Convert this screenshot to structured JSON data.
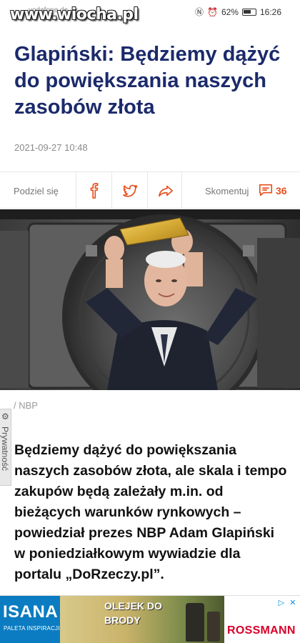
{
  "status_bar": {
    "watermark": "www.wiocha.pl",
    "carrier": "vodafone.de",
    "battery": "62%",
    "time": "16:26"
  },
  "article": {
    "headline": "Glapiński: Będziemy dążyć do powiększania naszych zasobów złota",
    "date": "2021-09-27 10:48",
    "photo_caption": "/ NBP",
    "lead": "Będziemy dążyć do powiększania naszych zasobów złota, ale skala i tempo zakupów będą zależały m.in. od bieżących warunków rynkowych – powiedział prezes NBP Adam Glapiński w poniedziałkowym wywiadzie dla portalu „DoRzeczy.pl”."
  },
  "share_bar": {
    "share_label": "Podziel się",
    "comment_label": "Skomentuj",
    "comment_count": "36",
    "accent": "#e84e1b"
  },
  "privacy_tab": {
    "label": "Prywatność"
  },
  "ad": {
    "brand": "ISANA",
    "brand_sub": "PALETA INSPIRACJI",
    "product": "OLEJEK DO BRODY",
    "retailer": "ROSSMANN",
    "brand_color": "#0b7cc1",
    "retailer_color": "#d9002a"
  },
  "colors": {
    "headline": "#1b2a6b",
    "accent": "#e84e1b"
  }
}
